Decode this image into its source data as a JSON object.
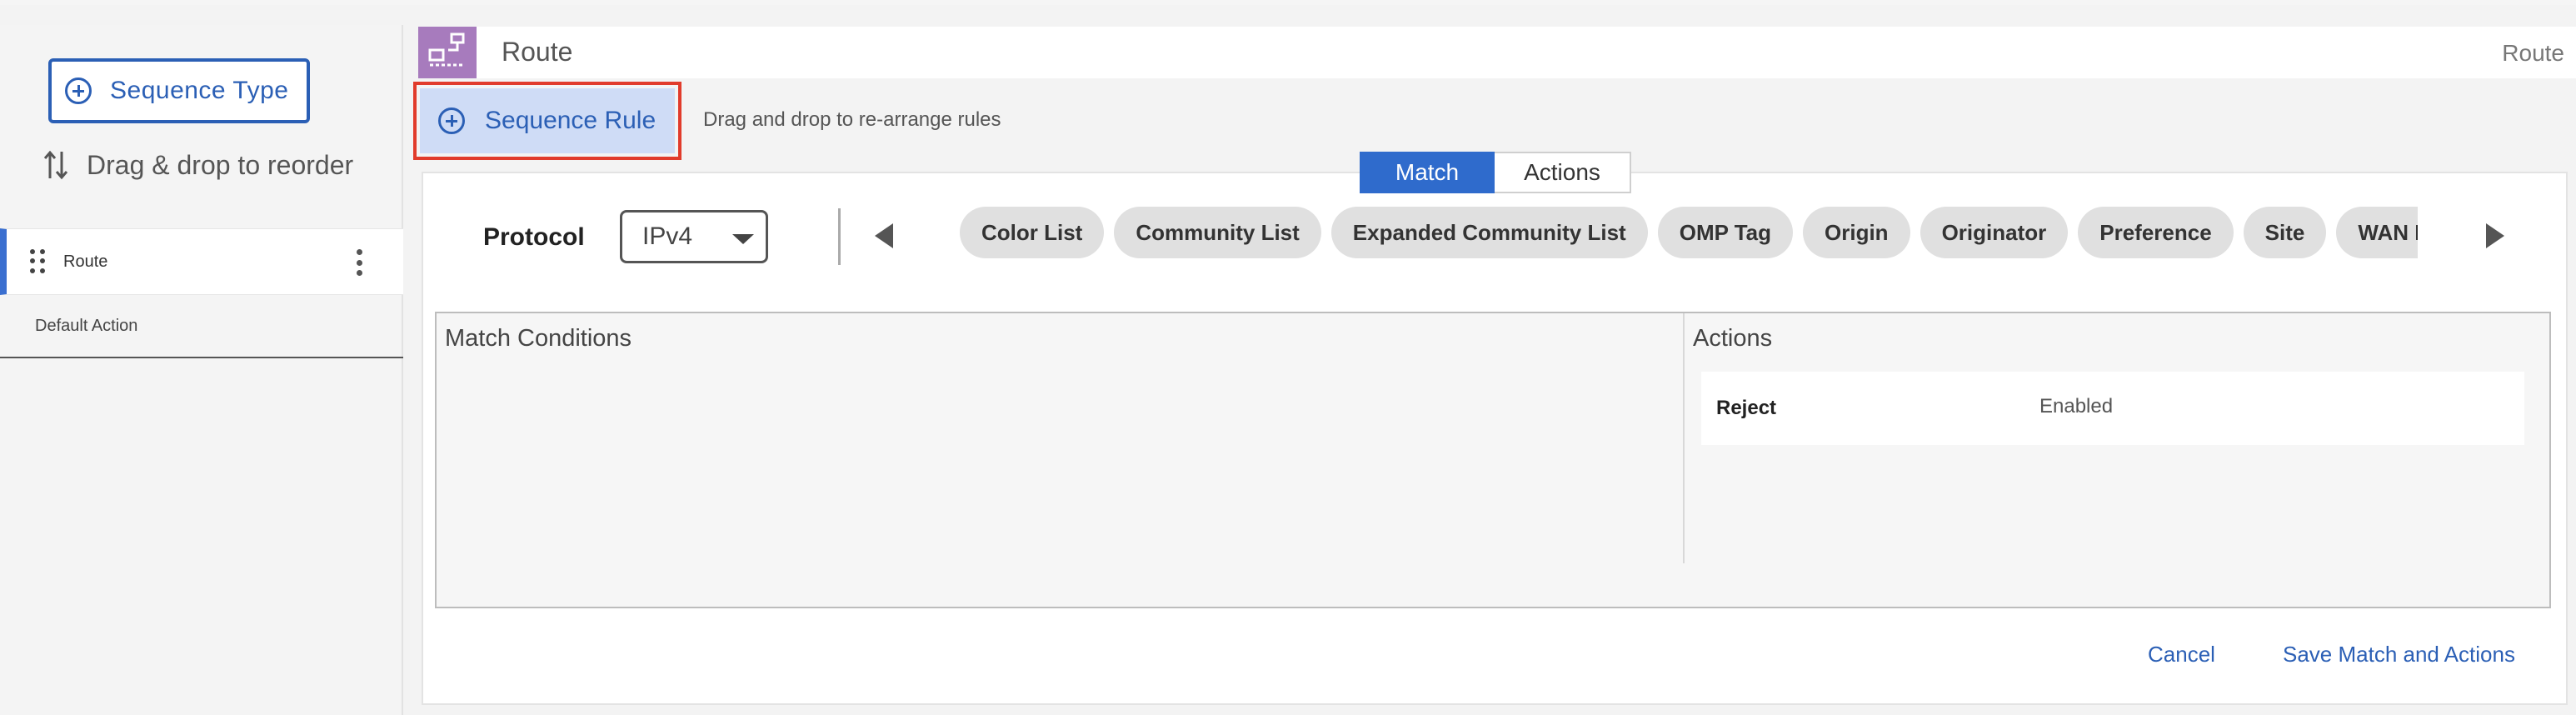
{
  "left_panel": {
    "sequence_type_label": "Sequence Type",
    "drag_hint": "Drag & drop to reorder",
    "items": [
      {
        "label": "Route",
        "selected": true
      },
      {
        "label": "Default Action",
        "selected": false
      }
    ]
  },
  "header": {
    "title": "Route",
    "right_label": "Route",
    "icon": "route-policy-icon",
    "icon_color": "#a77bbd"
  },
  "sequence_rule": {
    "label": "Sequence Rule",
    "hint": "Drag and drop to re-arrange rules"
  },
  "tabs": {
    "match": "Match",
    "actions": "Actions",
    "active": "Match"
  },
  "protocol": {
    "label": "Protocol",
    "selected": "IPv4"
  },
  "match_chips": [
    "Color List",
    "Community List",
    "Expanded Community List",
    "OMP Tag",
    "Origin",
    "Originator",
    "Preference",
    "Site",
    "WAN Re"
  ],
  "conditions": {
    "match_title": "Match Conditions",
    "actions_title": "Actions",
    "action_rows": [
      {
        "key": "Reject",
        "value": "Enabled"
      }
    ]
  },
  "footer": {
    "cancel": "Cancel",
    "save": "Save Match and Actions"
  },
  "colors": {
    "accent": "#2b5fb5",
    "highlight_border": "#e13b2b",
    "active_tab": "#2f6bcc"
  }
}
